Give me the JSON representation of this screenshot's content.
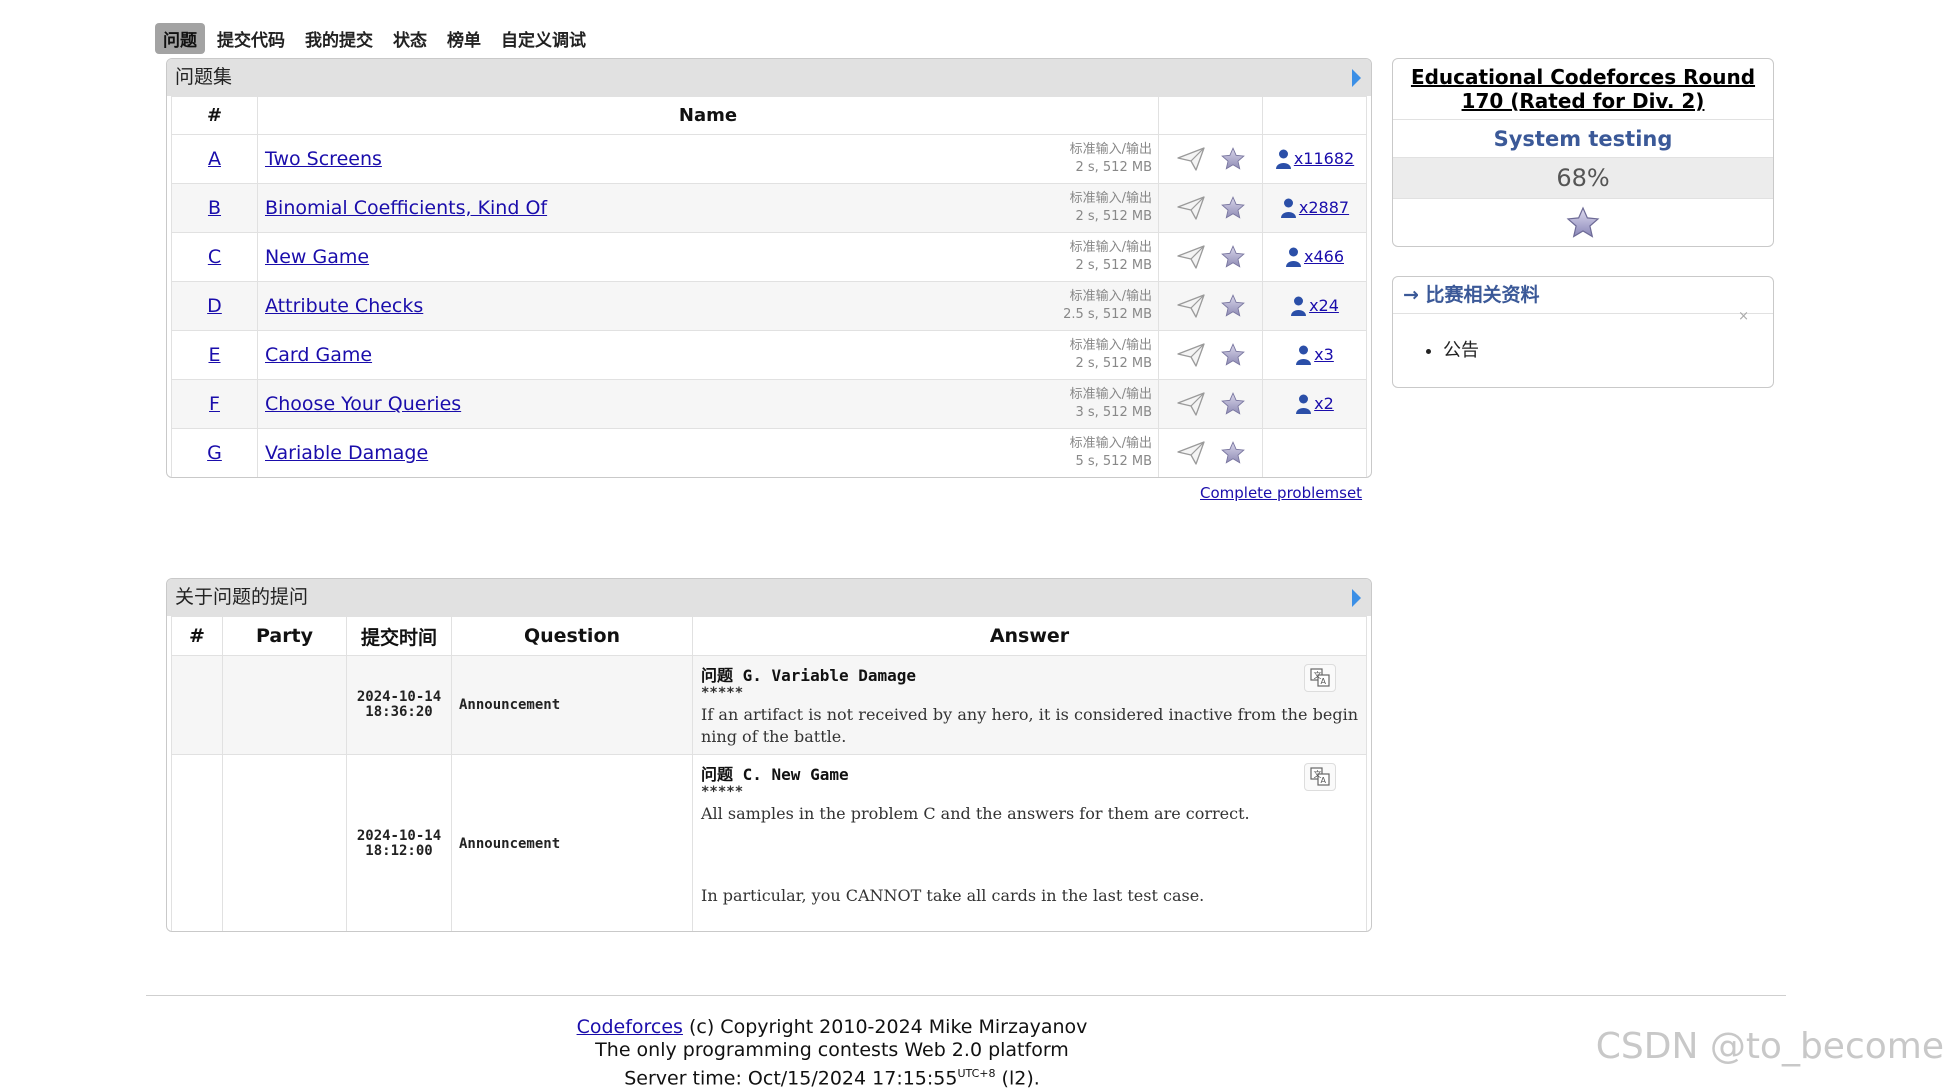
{
  "menu": [
    "问题",
    "提交代码",
    "我的提交",
    "状态",
    "榜单",
    "自定义调试"
  ],
  "problemset": {
    "caption": "问题集",
    "headers": {
      "index": "#",
      "name": "Name"
    },
    "rows": [
      {
        "index": "A",
        "name": "Two Screens",
        "io": "标准输入/输出",
        "limits": "2 s, 512 MB",
        "solved": "x11682"
      },
      {
        "index": "B",
        "name": "Binomial Coefficients, Kind Of",
        "io": "标准输入/输出",
        "limits": "2 s, 512 MB",
        "solved": "x2887"
      },
      {
        "index": "C",
        "name": "New Game",
        "io": "标准输入/输出",
        "limits": "2 s, 512 MB",
        "solved": "x466"
      },
      {
        "index": "D",
        "name": "Attribute Checks",
        "io": "标准输入/输出",
        "limits": "2.5 s, 512 MB",
        "solved": "x24"
      },
      {
        "index": "E",
        "name": "Card Game",
        "io": "标准输入/输出",
        "limits": "2 s, 512 MB",
        "solved": "x3"
      },
      {
        "index": "F",
        "name": "Choose Your Queries",
        "io": "标准输入/输出",
        "limits": "3 s, 512 MB",
        "solved": "x2"
      },
      {
        "index": "G",
        "name": "Variable Damage",
        "io": "标准输入/输出",
        "limits": "5 s, 512 MB",
        "solved": ""
      }
    ],
    "complete_link": "Complete problemset"
  },
  "sidebar": {
    "contest_title": "Educational Codeforces Round 170 (Rated for Div. 2)",
    "status": "System testing",
    "progress": "68%",
    "materials_title": "→ 比赛相关资料",
    "materials": [
      "公告"
    ],
    "remove_mark": "×"
  },
  "questions": {
    "caption": "关于问题的提问",
    "headers": [
      "#",
      "Party",
      "提交时间",
      "Question",
      "Answer"
    ],
    "rows": [
      {
        "date": "2024-10-14",
        "time": "18:36:20",
        "question": "Announcement",
        "answer_title": "问题 G. Variable Damage",
        "answer_stars": "*****",
        "answer_body": "If an artifact is not received by any hero, it is considered inactive from the beginning of the battle."
      },
      {
        "date": "2024-10-14",
        "time": "18:12:00",
        "question": "Announcement",
        "answer_title": "问题 C. New Game",
        "answer_stars": "*****",
        "answer_body": "All samples in the problem C and the answers for them are correct.",
        "answer_body2": "In particular, you CANNOT take all cards in the last test case."
      }
    ]
  },
  "footer": {
    "link": "Codeforces",
    "copyright": " (c) Copyright 2010-2024 Mike Mirzayanov",
    "tagline": "The only programming contests Web 2.0 platform",
    "server_time_label": "Server time: Oct/15/2024 17:15:55",
    "tz": "UTC+8",
    "server_suffix": " (l2)."
  },
  "watermark": "CSDN @to_become",
  "colors": {
    "accent": "#3b5998",
    "link": "#1a0dab",
    "caption_bg": "#e1e1e1"
  }
}
